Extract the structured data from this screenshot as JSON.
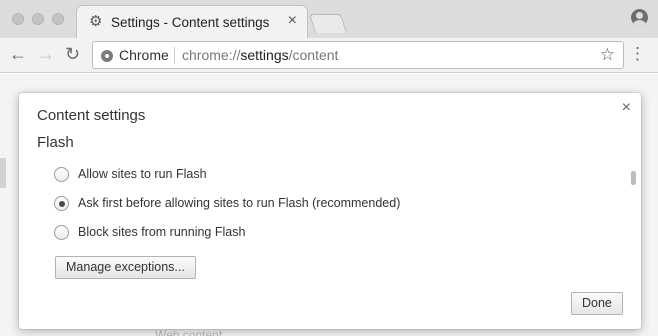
{
  "tab": {
    "title": "Settings - Content settings",
    "close": "×"
  },
  "toolbar": {
    "back": "←",
    "forward": "→",
    "reload": "↻",
    "origin_chip": "Chrome",
    "url_prefix": "chrome://",
    "url_host": "settings",
    "url_path": "/content",
    "star": "☆",
    "menu": "⋮"
  },
  "dialog": {
    "title": "Content settings",
    "close": "×",
    "section_title": "Flash",
    "options": [
      {
        "label": "Allow sites to run Flash",
        "checked": false
      },
      {
        "label": "Ask first before allowing sites to run Flash (recommended)",
        "checked": true
      },
      {
        "label": "Block sites from running Flash",
        "checked": false
      }
    ],
    "manage_exceptions": "Manage exceptions...",
    "done": "Done"
  },
  "background": {
    "partial_text": "Web content"
  },
  "icons": {
    "tab_favicon": "gear-icon",
    "profile": "person-icon",
    "origin": "chrome-logo-icon",
    "bookmark": "star-icon",
    "menu": "kebab-menu-icon"
  }
}
